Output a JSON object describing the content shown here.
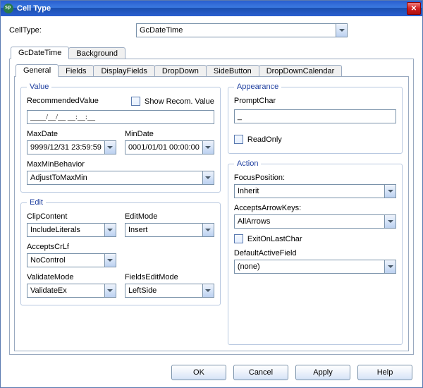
{
  "window": {
    "title": "Cell Type"
  },
  "top": {
    "label": "CellType:",
    "value": "GcDateTime"
  },
  "outerTabs": [
    "GcDateTime",
    "Background"
  ],
  "innerTabs": [
    "General",
    "Fields",
    "DisplayFields",
    "DropDown",
    "SideButton",
    "DropDownCalendar"
  ],
  "value": {
    "legend": "Value",
    "recommendedLabel": "RecommendedValue",
    "recommendedText": "____/__/__ __:__:__",
    "showRecomLabel": "Show Recom. Value",
    "maxDateLabel": "MaxDate",
    "maxDate": "9999/12/31 23:59:59",
    "minDateLabel": "MinDate",
    "minDate": "0001/01/01 00:00:00",
    "maxMinBehaviorLabel": "MaxMinBehavior",
    "maxMinBehavior": "AdjustToMaxMin"
  },
  "edit": {
    "legend": "Edit",
    "clipContentLabel": "ClipContent",
    "clipContent": "IncludeLiterals",
    "editModeLabel": "EditMode",
    "editMode": "Insert",
    "acceptsCrLfLabel": "AcceptsCrLf",
    "acceptsCrLf": "NoControl",
    "validateModeLabel": "ValidateMode",
    "validateMode": "ValidateEx",
    "fieldsEditModeLabel": "FieldsEditMode",
    "fieldsEditMode": "LeftSide"
  },
  "appearance": {
    "legend": "Appearance",
    "promptCharLabel": "PromptChar",
    "promptChar": "_",
    "readOnlyLabel": "ReadOnly"
  },
  "action": {
    "legend": "Action",
    "focusPositionLabel": "FocusPosition:",
    "focusPosition": "Inherit",
    "acceptsArrowKeysLabel": "AcceptsArrowKeys:",
    "acceptsArrowKeys": "AllArrows",
    "exitOnLastCharLabel": "ExitOnLastChar",
    "defaultActiveFieldLabel": "DefaultActiveField",
    "defaultActiveField": "(none)"
  },
  "buttons": {
    "ok": "OK",
    "cancel": "Cancel",
    "apply": "Apply",
    "help": "Help"
  }
}
